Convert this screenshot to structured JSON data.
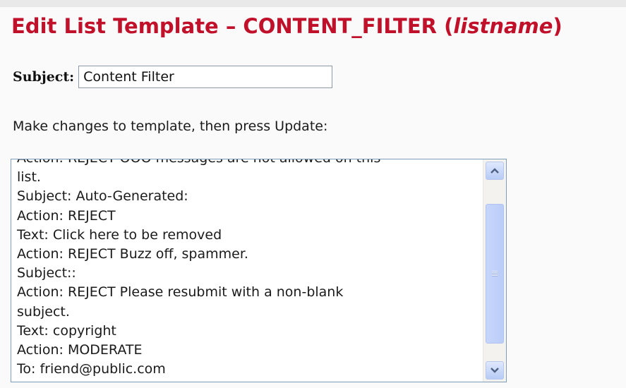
{
  "header": {
    "title_prefix": "Edit List Template – CONTENT_FILTER (",
    "title_listname": "listname",
    "title_suffix": ")"
  },
  "subject": {
    "label": "Subject:",
    "value": "Content Filter"
  },
  "instructions": "Make changes to template, then press Update:",
  "template_editor": {
    "lines": [
      "Action: REJECT OOO messages are not allowed on this",
      "list.",
      "Subject: Auto-Generated:",
      "Action: REJECT",
      "Text: Click here to be removed",
      "Action: REJECT Buzz off, spammer.",
      "Subject::",
      "Action: REJECT Please resubmit with a non-blank",
      "subject.",
      "Text: copyright",
      "Action: MODERATE",
      "To: friend@public.com"
    ]
  },
  "icons": {
    "scroll_up": "scroll-up-arrow-icon",
    "scroll_down": "scroll-down-arrow-icon"
  },
  "colors": {
    "title": "#c0102a",
    "scroll_accent": "#b7cbf5"
  }
}
